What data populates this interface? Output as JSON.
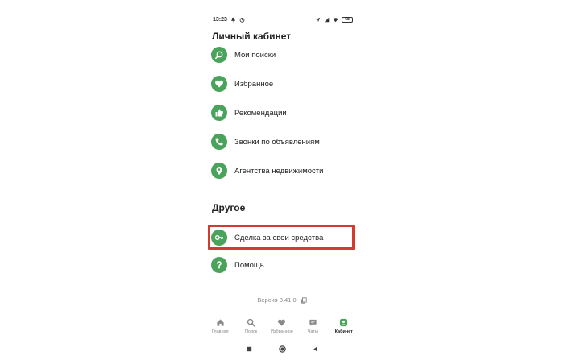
{
  "status_bar": {
    "time": "13:23",
    "battery": "68"
  },
  "sections": {
    "main_title": "Личный кабинет",
    "other_title": "Другое"
  },
  "menu_main": [
    {
      "label": "Мои поиски",
      "icon": "search-refresh-icon"
    },
    {
      "label": "Избранное",
      "icon": "heart-icon"
    },
    {
      "label": "Рекомендации",
      "icon": "thumbs-up-icon"
    },
    {
      "label": "Звонки по объявлениям",
      "icon": "phone-icon"
    },
    {
      "label": "Агентства недвижимости",
      "icon": "map-pin-icon"
    }
  ],
  "menu_other": [
    {
      "label": "Сделка за свои средства",
      "icon": "key-icon"
    },
    {
      "label": "Помощь",
      "icon": "question-icon"
    }
  ],
  "version": "Версия 8.41.0",
  "bottom_nav": [
    {
      "label": "Главная",
      "icon": "home-icon"
    },
    {
      "label": "Поиск",
      "icon": "search-icon"
    },
    {
      "label": "Избранное",
      "icon": "heart-icon"
    },
    {
      "label": "Чаты",
      "icon": "chat-icon"
    },
    {
      "label": "Кабинет",
      "icon": "profile-icon",
      "active": true
    }
  ],
  "colors": {
    "accent": "#4aa35a",
    "highlight": "#d23b2e",
    "text": "#222222",
    "muted": "#8a8a8a"
  }
}
